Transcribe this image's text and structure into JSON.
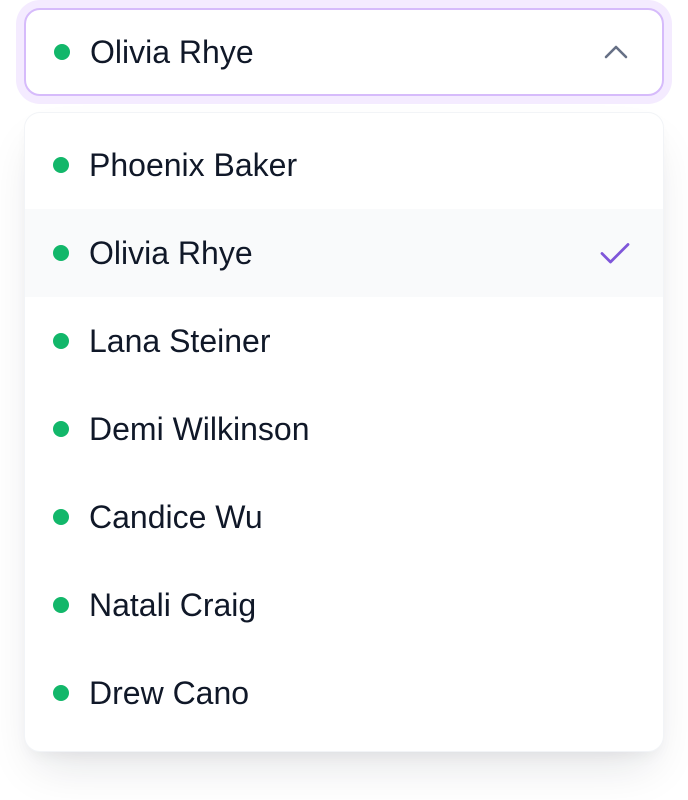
{
  "select": {
    "value": "Olivia Rhye",
    "status_color": "#12b76a",
    "open": true,
    "toggle_icon": "chevron-up-icon"
  },
  "menu": {
    "selected_index": 1,
    "check_icon": "check-icon",
    "accent_color": "#7f56d9",
    "options": [
      {
        "label": "Phoenix Baker"
      },
      {
        "label": "Olivia Rhye"
      },
      {
        "label": "Lana Steiner"
      },
      {
        "label": "Demi Wilkinson"
      },
      {
        "label": "Candice Wu"
      },
      {
        "label": "Natali Craig"
      },
      {
        "label": "Drew Cano"
      }
    ]
  }
}
